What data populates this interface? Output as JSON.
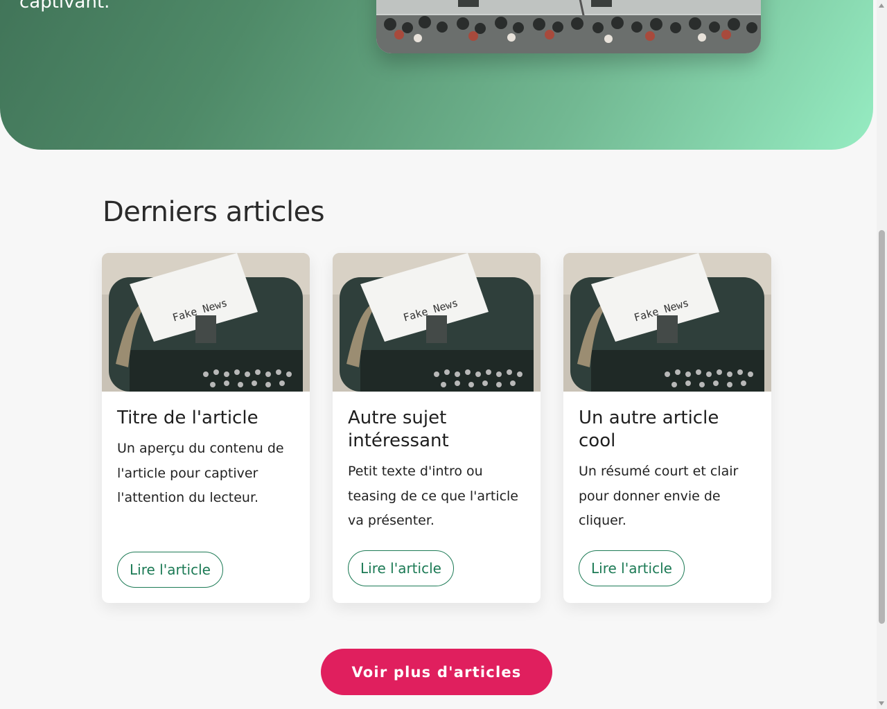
{
  "hero": {
    "text_tail": "captivant."
  },
  "articles_section": {
    "title": "Derniers articles",
    "cards": [
      {
        "title": "Titre de l'article",
        "excerpt": "Un aperçu du contenu de l'article pour captiver l'attention du lecteur.",
        "button_label": "Lire l'article",
        "image_caption": "Fake News"
      },
      {
        "title": "Autre sujet intéressant",
        "excerpt": "Petit texte d'intro ou teasing de ce que l'article va présenter.",
        "button_label": "Lire l'article",
        "image_caption": "Fake News"
      },
      {
        "title": "Un autre article cool",
        "excerpt": "Un résumé court et clair pour donner envie de cliquer.",
        "button_label": "Lire l'article",
        "image_caption": "Fake News"
      }
    ],
    "more_button_label": "Voir plus d'articles"
  },
  "colors": {
    "accent_green": "#1c7a55",
    "cta_pink": "#e01f5e",
    "hero_gradient_start": "#3b6b52",
    "hero_gradient_end": "#96ecc2"
  },
  "icons": {
    "scroll_up": "chevron-up-icon",
    "scroll_down": "chevron-down-icon"
  }
}
